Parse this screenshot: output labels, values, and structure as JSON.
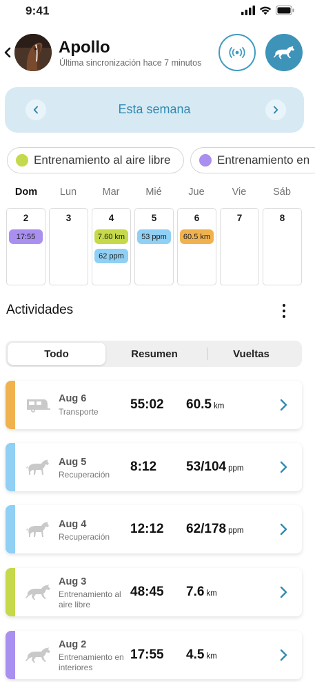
{
  "status_bar": {
    "time": "9:41"
  },
  "header": {
    "horse_name": "Apollo",
    "sync_text": "Última sincronización hace 7 minutos"
  },
  "week": {
    "label": "Esta semana"
  },
  "filters": [
    {
      "label": "Entrenamiento al aire libre",
      "color": "#c5d94a"
    },
    {
      "label": "Entrenamiento en",
      "color": "#a98ff0"
    }
  ],
  "calendar": {
    "days": [
      "Dom",
      "Lun",
      "Mar",
      "Mié",
      "Jue",
      "Vie",
      "Sáb"
    ],
    "dates": [
      "2",
      "3",
      "4",
      "5",
      "6",
      "7",
      "8"
    ],
    "tags": {
      "d2": [
        {
          "text": "17:55",
          "color": "#a98ff0"
        }
      ],
      "d4": [
        {
          "text": "7.60 km",
          "color": "#c5d94a"
        },
        {
          "text": "62 ppm",
          "color": "#8fd0f4"
        }
      ],
      "d5": [
        {
          "text": "53 ppm",
          "color": "#8fd0f4"
        }
      ],
      "d6": [
        {
          "text": "60.5 km",
          "color": "#f0b24e"
        }
      ]
    }
  },
  "activities": {
    "title": "Actividades",
    "tabs": [
      "Todo",
      "Resumen",
      "Vueltas"
    ],
    "items": [
      {
        "date": "Aug 6",
        "type": "Transporte",
        "duration": "55:02",
        "value": "60.5",
        "unit": "km",
        "color": "#f0b24e",
        "icon": "trailer-icon"
      },
      {
        "date": "Aug 5",
        "type": "Recuperación",
        "duration": "8:12",
        "value": "53/104",
        "unit": "ppm",
        "color": "#8fd0f4",
        "icon": "walking-horse-icon"
      },
      {
        "date": "Aug 4",
        "type": "Recuperación",
        "duration": "12:12",
        "value": "62/178",
        "unit": "ppm",
        "color": "#8fd0f4",
        "icon": "walking-horse-icon"
      },
      {
        "date": "Aug 3",
        "type": "Entrenamiento al aire libre",
        "duration": "48:45",
        "value": "7.6",
        "unit": "km",
        "color": "#c5d94a",
        "icon": "galloping-horse-icon"
      },
      {
        "date": "Aug 2",
        "type": "Entrenamiento en interiores",
        "duration": "17:55",
        "value": "4.5",
        "unit": "km",
        "color": "#a98ff0",
        "icon": "galloping-horse-icon"
      }
    ]
  }
}
